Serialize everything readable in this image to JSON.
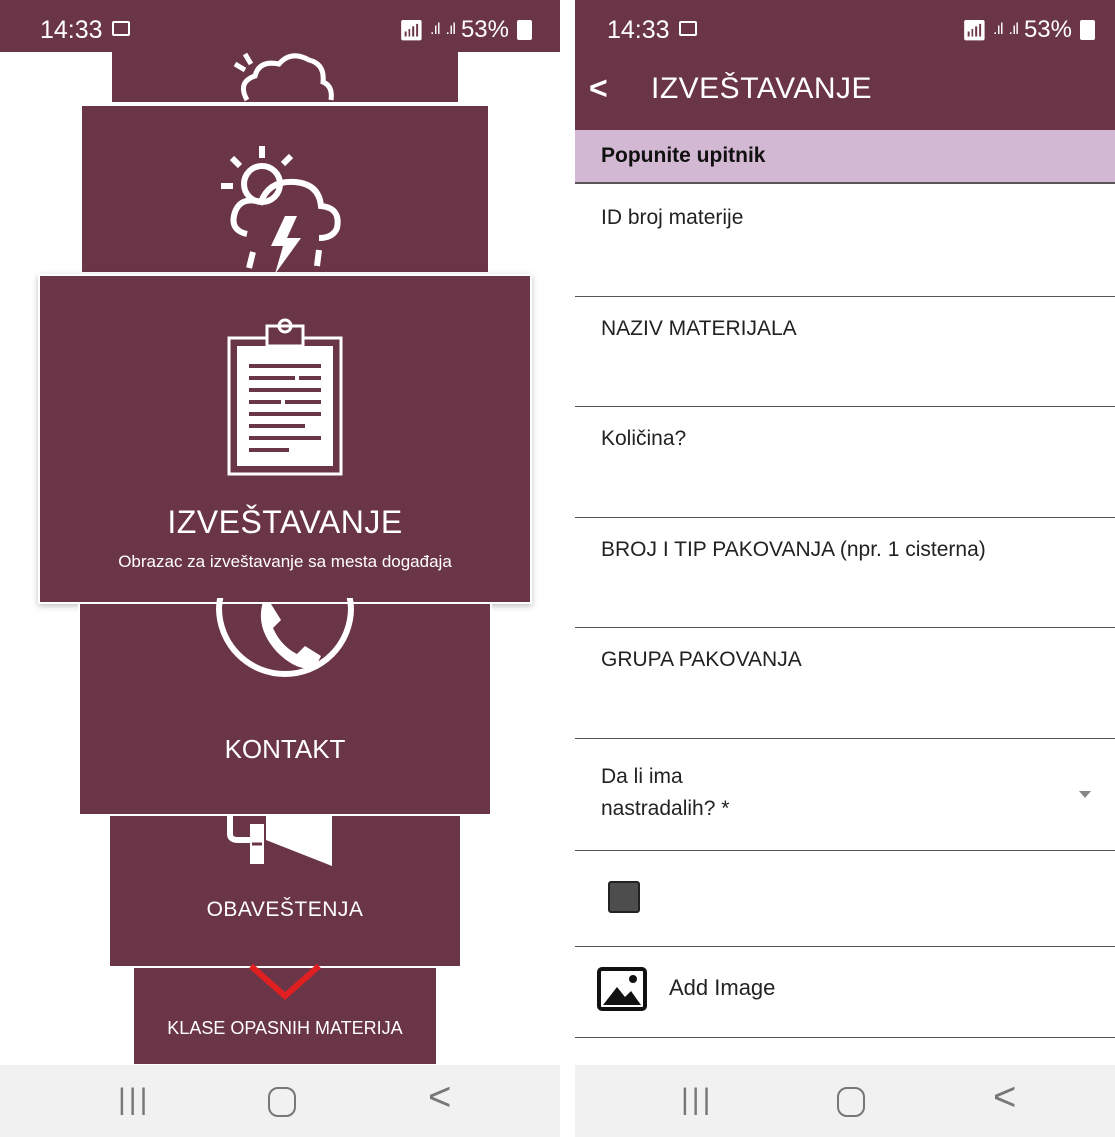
{
  "status_bar": {
    "time": "14:33",
    "battery": "53%"
  },
  "left_screen": {
    "cards": {
      "main": {
        "title": "IZVEŠTAVANJE",
        "subtitle": "Obrazac za izveštavanje sa mesta događaja"
      },
      "kontakt": {
        "label": "KONTAKT"
      },
      "obavestenja": {
        "label": "OBAVEŠTENJA"
      },
      "klase": {
        "label": "KLASE OPASNIH MATERIJA"
      }
    }
  },
  "right_screen": {
    "appbar": {
      "back": "<",
      "title": "IZVEŠTAVANJE"
    },
    "section_header": "Popunite upitnik",
    "fields": [
      {
        "label": "ID broj materije"
      },
      {
        "label": "NAZIV MATERIJALA"
      },
      {
        "label": "Količina?"
      },
      {
        "label": "BROJ I TIP PAKOVANJA (npr. 1 cisterna)"
      },
      {
        "label": "GRUPA PAKOVANJA"
      },
      {
        "label": "Da li ima\nnastradalih? *"
      }
    ],
    "add_image_label": "Add Image"
  },
  "nav_bar": {
    "recents": "|||",
    "back": "<"
  },
  "colors": {
    "brand": "#6b3548",
    "section_header": "#d2b8d3",
    "nav_bg": "#f1f1f1"
  }
}
